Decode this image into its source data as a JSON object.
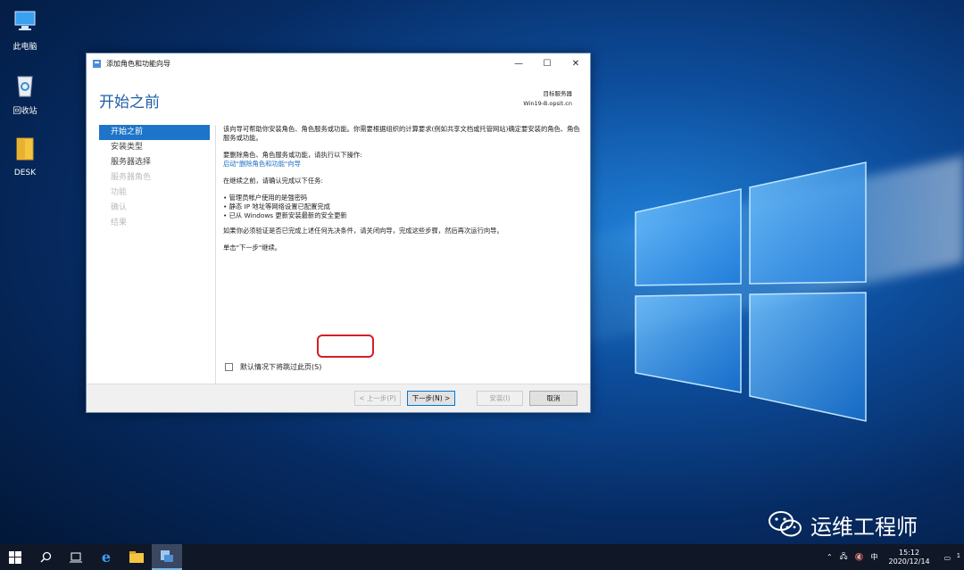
{
  "desktop": {
    "icons": [
      {
        "label": "此电脑",
        "icon": "computer-icon"
      },
      {
        "label": "回收站",
        "icon": "recycle-bin-icon"
      },
      {
        "label": "DESK",
        "icon": "folder-icon"
      }
    ]
  },
  "window": {
    "title": "添加角色和功能向导",
    "page_title": "开始之前",
    "target_label": "目标服务器",
    "target_server": "Win19-B.opsit.cn",
    "nav": [
      {
        "label": "开始之前",
        "state": "active"
      },
      {
        "label": "安装类型",
        "state": "normal"
      },
      {
        "label": "服务器选择",
        "state": "normal"
      },
      {
        "label": "服务器角色",
        "state": "disabled"
      },
      {
        "label": "功能",
        "state": "disabled"
      },
      {
        "label": "确认",
        "state": "disabled"
      },
      {
        "label": "结果",
        "state": "disabled"
      }
    ],
    "content": {
      "intro": "该向导可帮助你安装角色、角色服务或功能。你需要根据组织的计算要求(例如共享文档或托管网站)确定要安装的角色、角色服务或功能。",
      "remove_text": "要删除角色、角色服务或功能，请执行以下操作:",
      "remove_link": "启动\"删除角色和功能\"向导",
      "before_text": "在继续之前，请确认完成以下任务:",
      "tasks": [
        "管理员帐户使用的是强密码",
        "静态 IP 地址等网络设置已配置完成",
        "已从 Windows 更新安装最新的安全更新"
      ],
      "verify_text": "如果你必须验证是否已完成上述任何先决条件，请关闭向导，完成这些步骤，然后再次运行向导。",
      "next_hint": "单击\"下一步\"继续。"
    },
    "skip_label": "默认情况下将跳过此页(S)",
    "buttons": {
      "prev": "< 上一步(P)",
      "next": "下一步(N) >",
      "install": "安装(I)",
      "cancel": "取消"
    }
  },
  "watermark": {
    "text": "运维工程师"
  },
  "taskbar": {
    "ime": "中",
    "time": "15:12",
    "date": "2020/12/14",
    "notification_count": "1"
  },
  "colors": {
    "accent": "#1e74c8",
    "highlight": "#d21f26"
  }
}
